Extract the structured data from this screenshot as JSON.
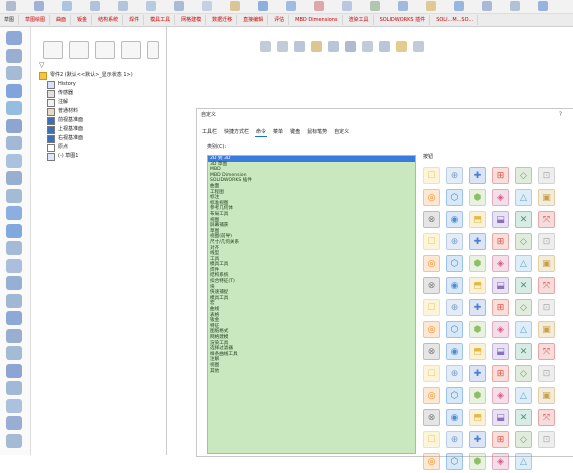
{
  "tabs": [
    {
      "label": "草图"
    },
    {
      "label": "草图绘图"
    },
    {
      "label": "曲面"
    },
    {
      "label": "钣金"
    },
    {
      "label": "结构系统"
    },
    {
      "label": "焊件"
    },
    {
      "label": "模具工具"
    },
    {
      "label": "网格建模"
    },
    {
      "label": "数据迁移"
    },
    {
      "label": "直接编辑"
    },
    {
      "label": "评估"
    },
    {
      "label": "MBD Dimensions"
    },
    {
      "label": "渲染工具"
    },
    {
      "label": "SOLIDWORKS 插件"
    },
    {
      "label": "SOLI...M...SO..."
    }
  ],
  "tree": {
    "root": "零件2 (默认<<默认>_显示状态 1>)",
    "items": [
      {
        "label": "History"
      },
      {
        "label": "传感器"
      },
      {
        "label": "注解"
      },
      {
        "label": "普通材料"
      },
      {
        "label": "前视基准面"
      },
      {
        "label": "上视基准面"
      },
      {
        "label": "右视基准面"
      },
      {
        "label": "原点"
      },
      {
        "label": "(-) 草图1"
      }
    ]
  },
  "dialog": {
    "title": "自定义",
    "close": "?",
    "tabs": [
      {
        "label": "工具栏"
      },
      {
        "label": "快捷方式栏"
      },
      {
        "label": "命令"
      },
      {
        "label": "菜单"
      },
      {
        "label": "键盘"
      },
      {
        "label": "鼠标笔势"
      },
      {
        "label": "自定义"
      }
    ],
    "category_label": "类别(C):",
    "buttons_label": "按钮",
    "categories": [
      "2D 到 3D",
      "3D 草图",
      "MBD",
      "MBD Dimension",
      "SOLIDWORKS 插件",
      "曲面",
      "工程图",
      "标注",
      "标准视图",
      "参考几何体",
      "布局工具",
      "视图",
      "屏幕捕获",
      "草图",
      "视图(前导)",
      "尺寸/几何关系",
      "对齐",
      "线型",
      "工具",
      "模具工具",
      "焊件",
      "结构系统",
      "扣合特征(T)",
      "块",
      "快速捕捉",
      "模具工具",
      "宏",
      "曲线",
      "表格",
      "钣金",
      "特征",
      "图纸格式",
      "网格建模",
      "渲染工具",
      "选择过滤器",
      "样条曲线工具",
      "注解",
      "视图",
      "其他"
    ]
  },
  "colors": {
    "accent": "#3b7be0",
    "list_bg": "#c9e8bf",
    "tab_red": "#cc0000"
  }
}
